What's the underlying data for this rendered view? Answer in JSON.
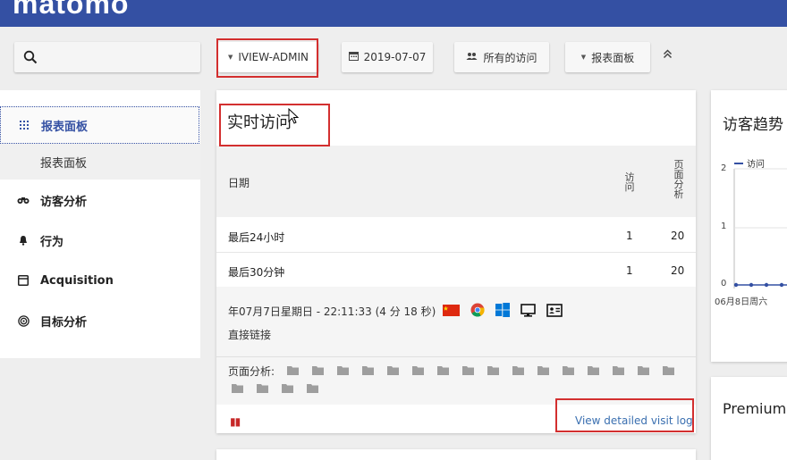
{
  "app": {
    "logo": "matomo"
  },
  "search": {
    "placeholder": ""
  },
  "toolbar": {
    "site": "IVIEW-ADMIN",
    "date": "2019-07-07",
    "segment": "所有的访问",
    "dashboard": "报表面板"
  },
  "sidebar": {
    "items": [
      {
        "label": "报表面板",
        "icon": "grid-icon",
        "active": true
      },
      {
        "label": "访客分析",
        "icon": "binoculars-icon"
      },
      {
        "label": "行为",
        "icon": "bell-icon"
      },
      {
        "label": "Acquisition",
        "icon": "window-icon"
      },
      {
        "label": "目标分析",
        "icon": "target-icon"
      }
    ],
    "subitems": [
      {
        "label": "报表面板"
      }
    ]
  },
  "realtime": {
    "title": "实时访问",
    "columns": {
      "date": "日期",
      "visits": "访问",
      "pageviews": "页面分析"
    },
    "rows": [
      {
        "label": "最后24小时",
        "visits": "1",
        "pageviews": "20"
      },
      {
        "label": "最后30分钟",
        "visits": "1",
        "pageviews": "20"
      }
    ],
    "visit": {
      "datetime": "年07月7日星期日 - 22:11:33 (4 分 18 秒)",
      "icons": [
        "china-flag-icon",
        "chrome-icon",
        "windows-icon",
        "desktop-icon",
        "contact-card-icon"
      ],
      "referrer": "直接链接",
      "pages_label": "页面分析:",
      "page_count": 20
    },
    "pause_icon": "pause-icon",
    "detail_link": "View detailed visit log"
  },
  "trend": {
    "title": "访客趋势",
    "legend": "访问",
    "y_ticks": [
      "2",
      "1",
      "0"
    ],
    "x_tick": "06月8日周六",
    "chart_data": {
      "type": "line",
      "series": [
        {
          "name": "访问",
          "values": [
            0,
            0,
            0,
            0,
            0
          ]
        }
      ],
      "x": [
        "06月8日周六"
      ],
      "ylim": [
        0,
        2
      ]
    }
  },
  "premium": {
    "title": "Premium"
  },
  "colors": {
    "brand": "#3450a3",
    "highlight_box": "#d32f2f",
    "link": "#3a6fb0",
    "pause": "#c62828"
  }
}
